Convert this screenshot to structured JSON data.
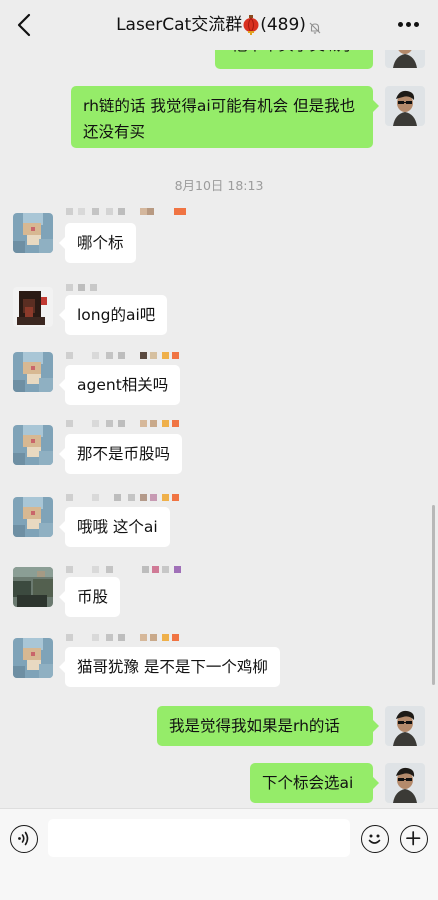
{
  "header": {
    "title": "LaserCat交流群",
    "member_count": "(489)",
    "back_icon": "chevron-left-icon",
    "lantern_icon": "red-lantern-icon",
    "mute_icon": "bell-off-icon",
    "more_icon": "more-dots-icon"
  },
  "messages": [
    {
      "side": "out",
      "text": "他下午买了交喊了"
    },
    {
      "side": "out",
      "text": "rh链的话 我觉得ai可能有机会 但是我也还没有买"
    },
    {
      "side": "in",
      "text": "哪个标"
    },
    {
      "side": "in",
      "text": "long的ai吧"
    },
    {
      "side": "in",
      "text": "agent相关吗"
    },
    {
      "side": "in",
      "text": "那不是币股吗"
    },
    {
      "side": "in",
      "text": "哦哦 这个ai"
    },
    {
      "side": "in",
      "text": "币股"
    },
    {
      "side": "in",
      "text": "猫哥犹豫 是不是下一个鸡柳"
    },
    {
      "side": "out",
      "text": "我是觉得我如果是rh的话"
    },
    {
      "side": "out",
      "text": "下个标会选ai"
    }
  ],
  "timestamp": "8月10日 18:13",
  "input_bar": {
    "voice_icon": "voice-icon",
    "emoji_icon": "emoji-icon",
    "plus_icon": "plus-icon",
    "input_value": ""
  },
  "colors": {
    "background": "#ededed",
    "outgoing_bubble": "#95ec69",
    "incoming_bubble": "#ffffff",
    "timestamp_text": "#9c9c9c"
  }
}
